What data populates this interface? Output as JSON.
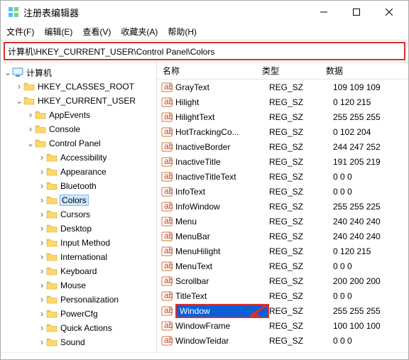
{
  "window": {
    "title": "注册表编辑器"
  },
  "menubar": [
    "文件(F)",
    "编辑(E)",
    "查看(V)",
    "收藏夹(A)",
    "帮助(H)"
  ],
  "addressbar": "计算机\\HKEY_CURRENT_USER\\Control Panel\\Colors",
  "tree": {
    "root": "计算机",
    "hives": [
      {
        "name": "HKEY_CLASSES_ROOT",
        "expanded": false
      },
      {
        "name": "HKEY_CURRENT_USER",
        "expanded": true,
        "children": [
          {
            "name": "AppEvents",
            "expanded": false
          },
          {
            "name": "Console",
            "expanded": false
          },
          {
            "name": "Control Panel",
            "expanded": true,
            "children": [
              {
                "name": "Accessibility"
              },
              {
                "name": "Appearance"
              },
              {
                "name": "Bluetooth"
              },
              {
                "name": "Colors",
                "selected": true
              },
              {
                "name": "Cursors"
              },
              {
                "name": "Desktop"
              },
              {
                "name": "Input Method"
              },
              {
                "name": "International"
              },
              {
                "name": "Keyboard"
              },
              {
                "name": "Mouse"
              },
              {
                "name": "Personalization"
              },
              {
                "name": "PowerCfg"
              },
              {
                "name": "Quick Actions"
              },
              {
                "name": "Sound"
              }
            ]
          }
        ]
      }
    ]
  },
  "list": {
    "columns": {
      "name": "名称",
      "type": "类型",
      "data": "数据"
    },
    "rows": [
      {
        "name": "GrayText",
        "type": "REG_SZ",
        "data": "109 109 109"
      },
      {
        "name": "Hilight",
        "type": "REG_SZ",
        "data": "0 120 215"
      },
      {
        "name": "HilightText",
        "type": "REG_SZ",
        "data": "255 255 255"
      },
      {
        "name": "HotTrackingCo...",
        "type": "REG_SZ",
        "data": "0 102 204"
      },
      {
        "name": "InactiveBorder",
        "type": "REG_SZ",
        "data": "244 247 252"
      },
      {
        "name": "InactiveTitle",
        "type": "REG_SZ",
        "data": "191 205 219"
      },
      {
        "name": "InactiveTitleText",
        "type": "REG_SZ",
        "data": "0 0 0"
      },
      {
        "name": "InfoText",
        "type": "REG_SZ",
        "data": "0 0 0"
      },
      {
        "name": "InfoWindow",
        "type": "REG_SZ",
        "data": "255 255 225"
      },
      {
        "name": "Menu",
        "type": "REG_SZ",
        "data": "240 240 240"
      },
      {
        "name": "MenuBar",
        "type": "REG_SZ",
        "data": "240 240 240"
      },
      {
        "name": "MenuHilight",
        "type": "REG_SZ",
        "data": "0 120 215"
      },
      {
        "name": "MenuText",
        "type": "REG_SZ",
        "data": "0 0 0"
      },
      {
        "name": "Scrollbar",
        "type": "REG_SZ",
        "data": "200 200 200"
      },
      {
        "name": "TitleText",
        "type": "REG_SZ",
        "data": "0 0 0"
      },
      {
        "name": "Window",
        "type": "REG_SZ",
        "data": "255 255 255",
        "selected": true
      },
      {
        "name": "WindowFrame",
        "type": "REG_SZ",
        "data": "100 100 100"
      },
      {
        "name": "WindowTeidar",
        "type": "REG_SZ",
        "data": "0 0 0"
      }
    ]
  }
}
